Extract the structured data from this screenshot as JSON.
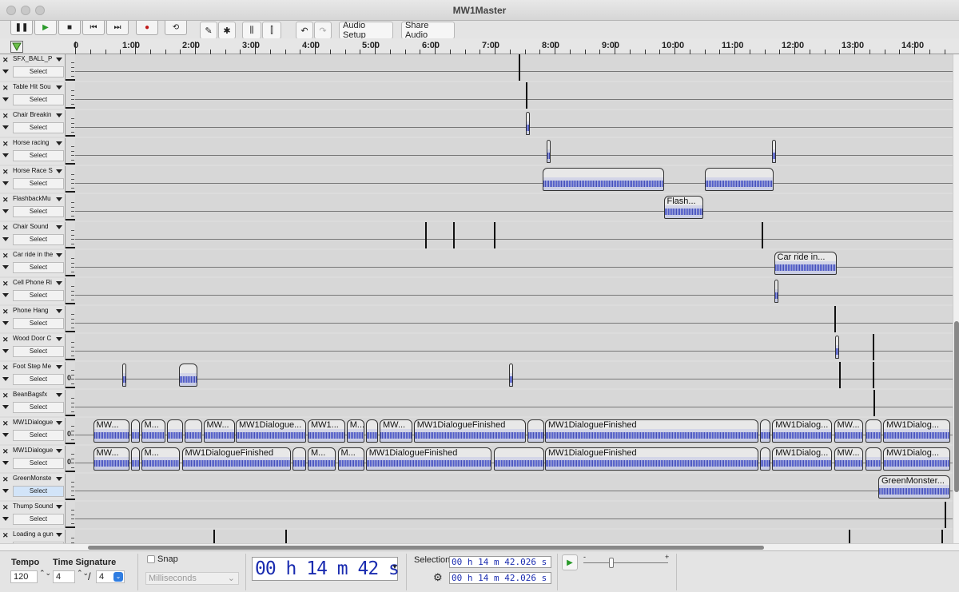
{
  "window": {
    "title": "MW1Master"
  },
  "toolbar": {
    "audio_setup": "Audio Setup",
    "share_audio": "Share Audio"
  },
  "ruler": {
    "labels": [
      "0",
      "1:00",
      "2:00",
      "3:00",
      "4:00",
      "5:00",
      "6:00",
      "7:00",
      "8:00",
      "9:00",
      "10:00",
      "11:00",
      "12:00",
      "13:00",
      "14:00"
    ]
  },
  "tracks": [
    {
      "name": "SFX_BALL_P",
      "select": "Select",
      "bars": [
        7.4
      ],
      "clips": []
    },
    {
      "name": "Table Hit Sou",
      "select": "Select",
      "bars": [
        7.52
      ],
      "clips": []
    },
    {
      "name": "Chair Breakin",
      "select": "Select",
      "bars": [],
      "clips": [
        {
          "start": 7.52,
          "end": 7.57,
          "label": ""
        }
      ]
    },
    {
      "name": "Horse racing",
      "select": "Select",
      "bars": [],
      "clips": [
        {
          "start": 7.86,
          "end": 7.92,
          "label": ""
        },
        {
          "start": 11.62,
          "end": 11.68,
          "label": ""
        }
      ]
    },
    {
      "name": "Horse Race S",
      "select": "Select",
      "bars": [],
      "clips": [
        {
          "start": 7.8,
          "end": 9.82,
          "label": ""
        },
        {
          "start": 10.5,
          "end": 11.65,
          "label": ""
        }
      ]
    },
    {
      "name": "FlashbackMu",
      "select": "Select",
      "bars": [],
      "clips": [
        {
          "start": 9.82,
          "end": 10.48,
          "label": "Flash..."
        }
      ]
    },
    {
      "name": "Chair Sound",
      "select": "Select",
      "bars": [
        5.84,
        6.3,
        6.98,
        11.45
      ],
      "clips": []
    },
    {
      "name": "Car ride in the",
      "select": "Select",
      "bars": [],
      "clips": [
        {
          "start": 11.66,
          "end": 12.7,
          "label": "Car ride in..."
        }
      ]
    },
    {
      "name": "Cell Phone Ri",
      "select": "Select",
      "bars": [],
      "clips": [
        {
          "start": 11.66,
          "end": 11.72,
          "label": ""
        }
      ]
    },
    {
      "name": "Phone Hang",
      "select": "Select",
      "bars": [
        12.66
      ],
      "clips": []
    },
    {
      "name": "Wood Door C",
      "select": "Select",
      "bars": [
        13.3
      ],
      "clips": [
        {
          "start": 12.68,
          "end": 12.74,
          "label": ""
        }
      ]
    },
    {
      "name": "Foot Step Me",
      "select": "Select",
      "zero": "0",
      "bars": [
        12.74,
        13.3
      ],
      "clips": [
        {
          "start": 0.78,
          "end": 0.84,
          "label": ""
        },
        {
          "start": 1.73,
          "end": 2.04,
          "label": ""
        },
        {
          "start": 7.24,
          "end": 7.3,
          "label": ""
        }
      ]
    },
    {
      "name": "BeanBagsfx",
      "select": "Select",
      "bars": [
        13.32
      ],
      "clips": []
    },
    {
      "name": "MW1Dialogue",
      "select": "Select",
      "zero": "0",
      "bars": [],
      "clips": [
        {
          "start": 0.3,
          "end": 0.9,
          "label": "MW..."
        },
        {
          "start": 0.93,
          "end": 1.08,
          "label": ""
        },
        {
          "start": 1.1,
          "end": 1.5,
          "label": "M..."
        },
        {
          "start": 1.53,
          "end": 1.8,
          "label": ""
        },
        {
          "start": 1.82,
          "end": 2.12,
          "label": ""
        },
        {
          "start": 2.14,
          "end": 2.66,
          "label": "MW..."
        },
        {
          "start": 2.68,
          "end": 3.85,
          "label": "MW1Dialogue..."
        },
        {
          "start": 3.88,
          "end": 4.5,
          "label": "MW1..."
        },
        {
          "start": 4.53,
          "end": 4.82,
          "label": "M..."
        },
        {
          "start": 4.85,
          "end": 5.05,
          "label": ""
        },
        {
          "start": 5.08,
          "end": 5.63,
          "label": "MW..."
        },
        {
          "start": 5.65,
          "end": 7.52,
          "label": "MW1DialogueFinished"
        },
        {
          "start": 7.55,
          "end": 7.82,
          "label": ""
        },
        {
          "start": 7.84,
          "end": 11.4,
          "label": "MW1DialogueFinished"
        },
        {
          "start": 11.43,
          "end": 11.6,
          "label": ""
        },
        {
          "start": 11.63,
          "end": 12.63,
          "label": "MW1Dialog..."
        },
        {
          "start": 12.66,
          "end": 13.15,
          "label": "MW..."
        },
        {
          "start": 13.18,
          "end": 13.45,
          "label": ""
        },
        {
          "start": 13.48,
          "end": 14.6,
          "label": "MW1Dialog..."
        }
      ]
    },
    {
      "name": "MW1Dialogue",
      "select": "Select",
      "zero": "0",
      "bars": [],
      "clips": [
        {
          "start": 0.3,
          "end": 0.9,
          "label": "MW..."
        },
        {
          "start": 0.93,
          "end": 1.08,
          "label": ""
        },
        {
          "start": 1.1,
          "end": 1.75,
          "label": "M..."
        },
        {
          "start": 1.78,
          "end": 3.6,
          "label": "MW1DialogueFinished"
        },
        {
          "start": 3.63,
          "end": 3.85,
          "label": ""
        },
        {
          "start": 3.88,
          "end": 4.35,
          "label": "M..."
        },
        {
          "start": 4.38,
          "end": 4.82,
          "label": "M..."
        },
        {
          "start": 4.85,
          "end": 6.95,
          "label": "MW1DialogueFinished"
        },
        {
          "start": 6.98,
          "end": 7.82,
          "label": ""
        },
        {
          "start": 7.84,
          "end": 11.4,
          "label": "MW1DialogueFinished"
        },
        {
          "start": 11.43,
          "end": 11.6,
          "label": ""
        },
        {
          "start": 11.63,
          "end": 12.63,
          "label": "MW1Dialog..."
        },
        {
          "start": 12.66,
          "end": 13.15,
          "label": "MW..."
        },
        {
          "start": 13.18,
          "end": 13.45,
          "label": ""
        },
        {
          "start": 13.48,
          "end": 14.6,
          "label": "MW1Dialog..."
        }
      ]
    },
    {
      "name": "GreenMonste",
      "select": "Select",
      "highlight": true,
      "bars": [],
      "clips": [
        {
          "start": 13.4,
          "end": 14.6,
          "label": "GreenMonster..."
        }
      ]
    },
    {
      "name": "Thump Sound",
      "select": "Select",
      "bars": [
        14.5
      ],
      "clips": []
    },
    {
      "name": "Loading a gun",
      "select": "Select",
      "bars": [
        2.3,
        3.5,
        12.9,
        14.45
      ],
      "clips": []
    }
  ],
  "bottom": {
    "tempo_label": "Tempo",
    "tempo_value": "120",
    "time_sig_label": "Time Signature",
    "time_sig_num": "4",
    "time_sig_slash": "/",
    "time_sig_den": "4",
    "snap_label": "Snap",
    "snap_unit": "Milliseconds",
    "big_time": "00 h 14 m 42 s",
    "selection_label": "Selection",
    "sel_start": "00 h 14 m 42.026 s",
    "sel_end": "00 h 14 m 42.026 s",
    "speed_min": "-",
    "speed_max": "+"
  }
}
